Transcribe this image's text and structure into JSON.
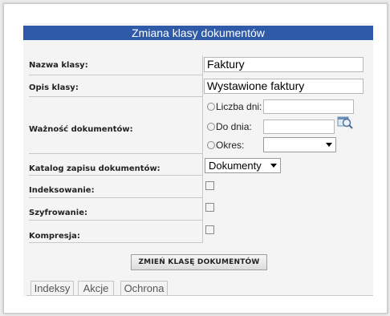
{
  "dialog": {
    "title": "Zmiana klasy dokumentów"
  },
  "fields": {
    "class_name": {
      "label": "Nazwa klasy:",
      "value": "Faktury"
    },
    "class_description": {
      "label": "Opis klasy:",
      "value": "Wystawione faktury"
    },
    "validity": {
      "label": "Ważność dokumentów:",
      "options": [
        {
          "label": "Liczba dni:",
          "value": ""
        },
        {
          "label": "Do dnia:",
          "value": ""
        },
        {
          "label": "Okres:",
          "value": ""
        }
      ]
    },
    "storage_catalog": {
      "label": "Katalog zapisu dokumentów:",
      "value": "Dokumenty"
    },
    "indexing": {
      "label": "Indeksowanie:",
      "checked": false
    },
    "encryption": {
      "label": "Szyfrowanie:",
      "checked": false
    },
    "compression": {
      "label": "Kompresja:",
      "checked": false
    }
  },
  "actions": {
    "submit_label": "ZMIEŃ KLASĘ DOKUMENTÓW"
  },
  "tabs": [
    {
      "label": "Indeksy"
    },
    {
      "label": "Akcje"
    },
    {
      "label": "Ochrona"
    }
  ],
  "colors": {
    "title_bar": "#2f5aa8",
    "page_background": "#ececec"
  }
}
